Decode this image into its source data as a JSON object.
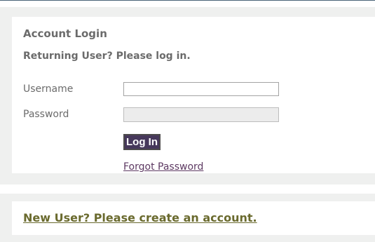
{
  "login": {
    "title": "Account Login",
    "subtitle": "Returning User? Please log in.",
    "username_label": "Username",
    "username_value": "",
    "password_label": "Password",
    "password_value": "",
    "submit_label": "Log In",
    "forgot_password_label": "Forgot Password"
  },
  "new_user": {
    "link_label": "New User? Please create an account."
  },
  "colors": {
    "panel_background": "#eff0ef",
    "text_gray": "#6b6b6b",
    "button_background": "#46385b",
    "forgot_link": "#5d3962",
    "new_user_link": "#6a6a2e"
  }
}
